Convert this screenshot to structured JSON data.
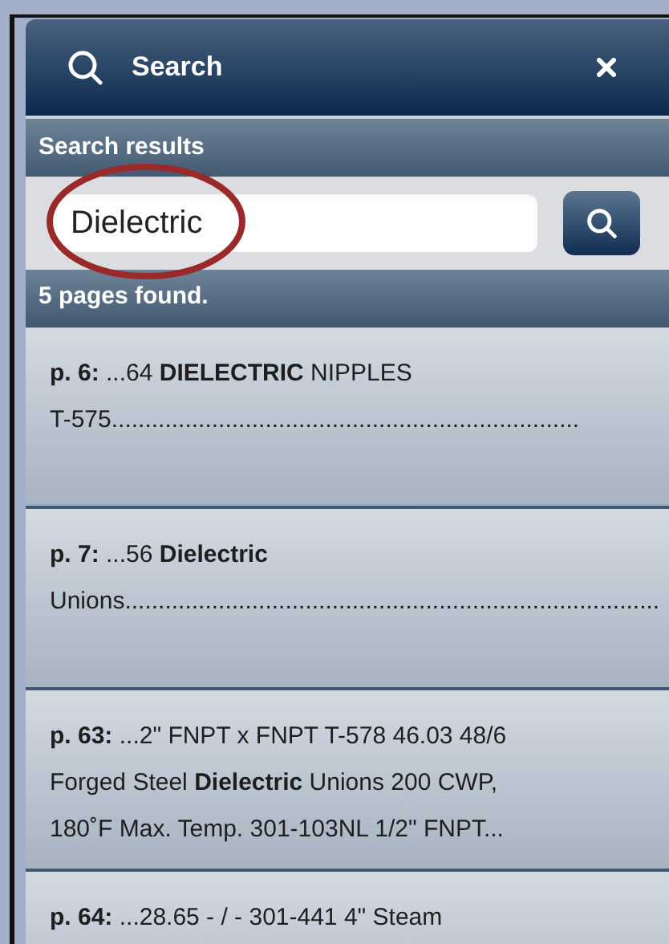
{
  "panel": {
    "title": "Search",
    "section_label": "Search results",
    "search": {
      "value": "Dielectric"
    },
    "status": "5 pages found."
  },
  "results": [
    {
      "lines": [
        "**p. 6:** ...64 **DIELECTRIC** NIPPLES",
        "T-575......................................................................"
      ]
    },
    {
      "lines": [
        "**p. 7:** ...56 **Dielectric**",
        "Unions................................................................................"
      ]
    },
    {
      "lines": [
        "**p. 63:** ...2\" FNPT x FNPT T-578 46.03 48/6",
        "Forged Steel **Dielectric** Unions 200 CWP,",
        "180˚F Max. Temp. 301-103NL 1/2\" FNPT..."
      ]
    },
    {
      "lines": [
        "**p. 64:** ...28.65 - / - 301-441 4\" Steam"
      ]
    }
  ]
}
